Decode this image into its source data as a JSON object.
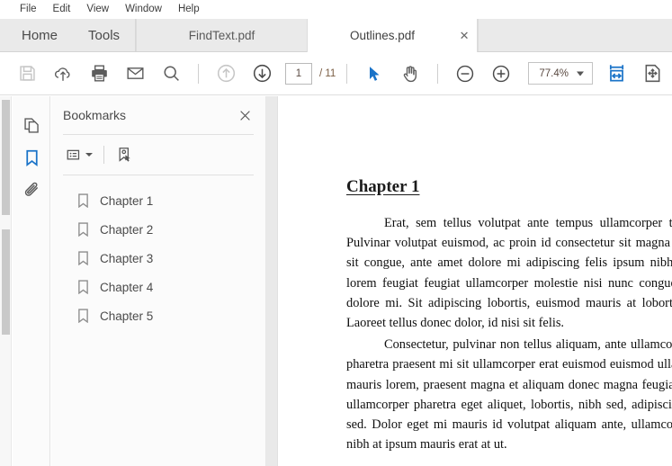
{
  "menubar": {
    "items": [
      {
        "label": "File"
      },
      {
        "label": "Edit"
      },
      {
        "label": "View"
      },
      {
        "label": "Window"
      },
      {
        "label": "Help"
      }
    ]
  },
  "tabbar": {
    "home_label": "Home",
    "tools_label": "Tools",
    "documents": [
      {
        "label": "FindText.pdf",
        "active": false
      },
      {
        "label": "Outlines.pdf",
        "active": true,
        "close_glyph": "✕"
      }
    ]
  },
  "toolbar": {
    "save_icon": "save-floppy-icon",
    "upload_icon": "cloud-upload-icon",
    "print_icon": "print-icon",
    "email_icon": "email-icon",
    "search_icon": "search-icon",
    "prev_page_icon": "arrow-up-circle-icon",
    "next_page_icon": "arrow-down-circle-icon",
    "page_number": "1",
    "page_total": "/ 11",
    "select_tool_icon": "cursor-arrow-icon",
    "hand_tool_icon": "hand-pan-icon",
    "zoom_out_icon": "zoom-out-icon",
    "zoom_in_icon": "zoom-in-icon",
    "zoom_level": "77.4%",
    "fit_width_icon": "fit-width-icon",
    "fit_page_icon": "fit-page-icon",
    "accent_color": "#1a73c8",
    "disabled_color": "#c6c6c6"
  },
  "rail": {
    "items": [
      {
        "name": "page-thumbnails-icon",
        "active": false
      },
      {
        "name": "bookmarks-icon",
        "active": true
      },
      {
        "name": "attachments-icon",
        "active": false
      }
    ]
  },
  "panel": {
    "title": "Bookmarks",
    "close_glyph": "✕",
    "options_icon": "bookmark-options-icon",
    "new_bookmark_icon": "new-bookmark-icon",
    "bookmarks": [
      {
        "label": "Chapter 1"
      },
      {
        "label": "Chapter 2"
      },
      {
        "label": "Chapter 3"
      },
      {
        "label": "Chapter 4"
      },
      {
        "label": "Chapter 5"
      }
    ]
  },
  "document": {
    "heading": "Chapter 1",
    "paragraph1": "Erat, sem tellus volutpat ante tempus ullamcorper tincidunt sit amet. Pulvinar volutpat euismod, ac proin id consectetur sit magna praesent et dolore sit congue, ante amet dolore mi adipiscing felis ipsum nibh felis ullamcorper lorem feugiat feugiat ullamcorper molestie nisi nunc congue laoreet et donec dolore mi. Sit adipiscing lobortis, euismod mauris at lobortis sit nibh ipsum. Laoreet tellus donec dolor, id nisi sit felis.",
    "paragraph2": "Consectetur, pulvinar non tellus aliquam, ante ullamcorper sit. Feugiat at pharetra praesent mi sit ullamcorper erat euismod euismod ullamcorper felis erat mauris lorem, praesent magna et aliquam donec magna feugiat sit mi non turpis ullamcorper pharetra eget aliquet, lobortis, nibh sed, adipiscing erat nisi massa sed. Dolor eget mi mauris id volutpat aliquam ante, ullamcorper adipiscing sit nibh at ipsum mauris erat at ut."
  }
}
